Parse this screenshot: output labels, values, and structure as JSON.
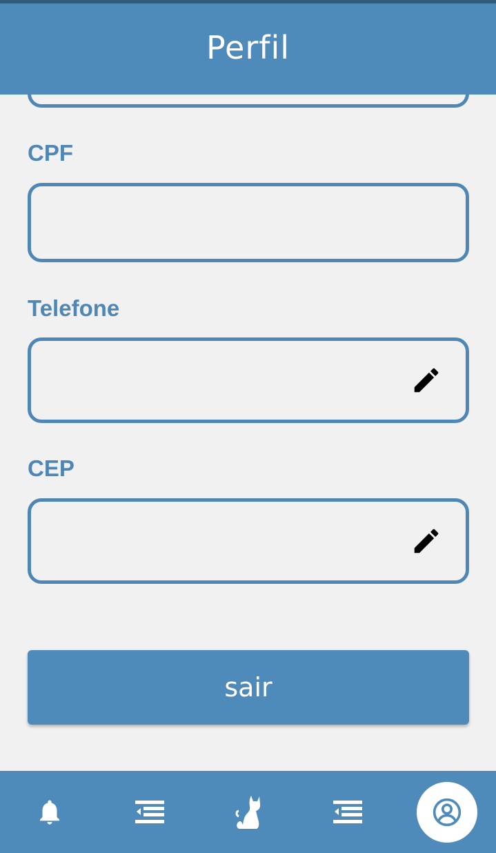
{
  "header": {
    "title": "Perfil"
  },
  "form": {
    "cpf_label": "CPF",
    "cpf_value": "",
    "phone_label": "Telefone",
    "phone_value": "",
    "cep_label": "CEP",
    "cep_value": ""
  },
  "actions": {
    "logout_label": "sair"
  },
  "bottom_nav": {
    "items": [
      {
        "icon": "bell-icon"
      },
      {
        "icon": "list-indent-icon"
      },
      {
        "icon": "cat-icon"
      },
      {
        "icon": "list-indent-icon"
      },
      {
        "icon": "user-circle-icon",
        "active": true
      }
    ]
  },
  "colors": {
    "primary": "#4e8aba",
    "field_border": "#4e86b5",
    "background": "#f1f1f2"
  }
}
